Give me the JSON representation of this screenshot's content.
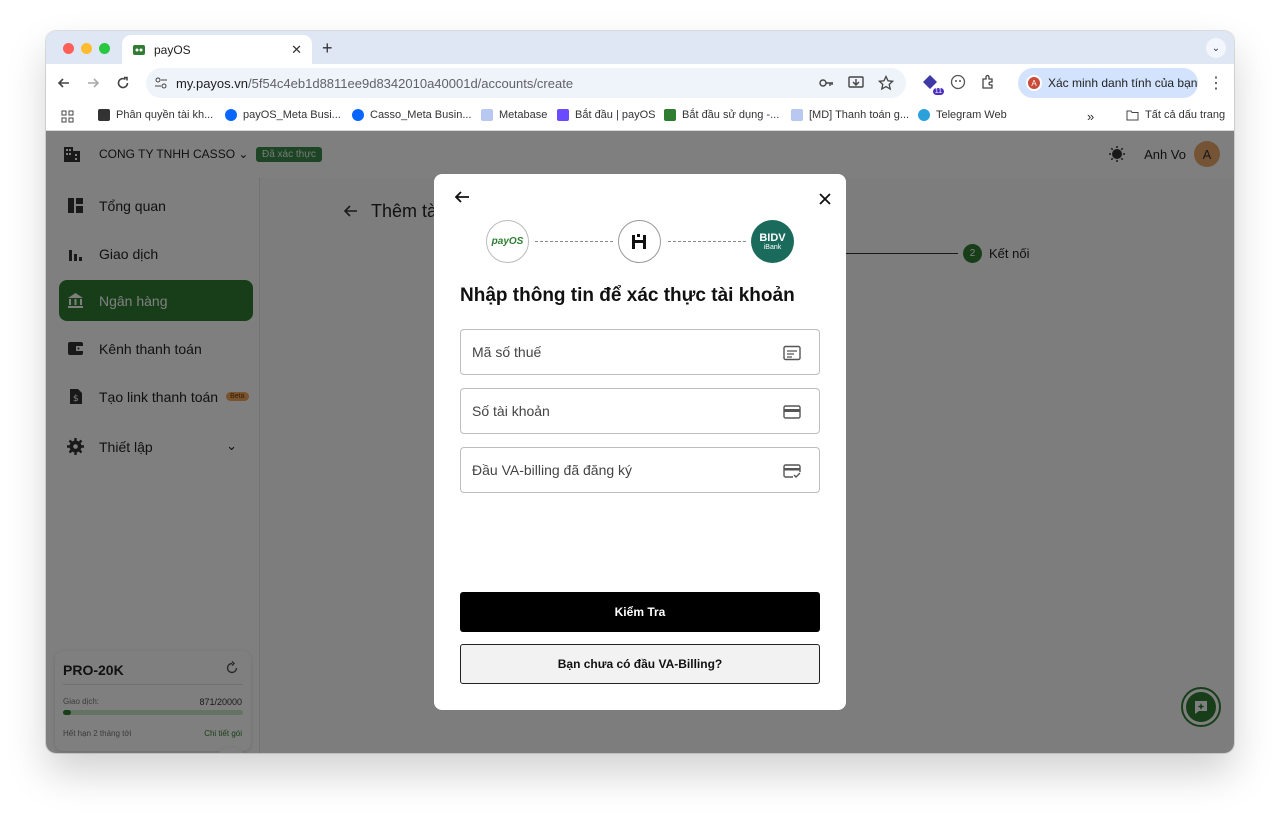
{
  "browser": {
    "tab_title": "payOS",
    "url_host": "my.payos.vn",
    "url_path": "/5f54c4eb1d8811ee9d8342010a40001d/accounts/create",
    "profile_label": "Xác minh danh tính của bạn",
    "extension_badge": "11"
  },
  "bookmarks": [
    "Phân quyền tài kh...",
    "payOS_Meta Busi...",
    "Casso_Meta Busin...",
    "Metabase",
    "Bắt đầu | payOS",
    "Bắt đầu sử dụng -...",
    "[MD] Thanh toán g...",
    "Telegram Web"
  ],
  "bookmarks_all": "Tất cả dấu trang",
  "header": {
    "company": "CONG TY TNHH CASSO",
    "verified": "Đã xác thực",
    "user_name": "Anh Vo",
    "user_initial": "A"
  },
  "sidebar": {
    "items": [
      {
        "label": "Tổng quan"
      },
      {
        "label": "Giao dịch"
      },
      {
        "label": "Ngân hàng"
      },
      {
        "label": "Kênh thanh toán"
      },
      {
        "label": "Tạo link thanh toán",
        "badge": "Beta"
      },
      {
        "label": "Thiết lập"
      }
    ],
    "plan": {
      "name": "PRO-20K",
      "usage_label": "Giao dịch:",
      "usage_value": "871/20000",
      "usage_fraction": 0.04355,
      "expiry": "Hết hạn 2 tháng tới",
      "details_link": "Chi tiết gói"
    }
  },
  "main": {
    "title": "Thêm tà",
    "step_number": "2",
    "step_label": "Kết nối"
  },
  "modal": {
    "title": "Nhập thông tin để xác thực tài khoản",
    "logo_payos": "payOS",
    "logo_bidv": "BIDV",
    "logo_bidv_sub": "iBank",
    "fields": {
      "tax_code": "Mã số thuế",
      "account_number": "Số tài khoản",
      "va_prefix": "Đầu VA-billing đã đăng ký"
    },
    "primary_button": "Kiểm Tra",
    "secondary_button": "Bạn chưa có đầu VA-Billing?"
  },
  "colors": {
    "brand_green": "#2e7d32",
    "bidv_teal": "#1b6b5d"
  }
}
